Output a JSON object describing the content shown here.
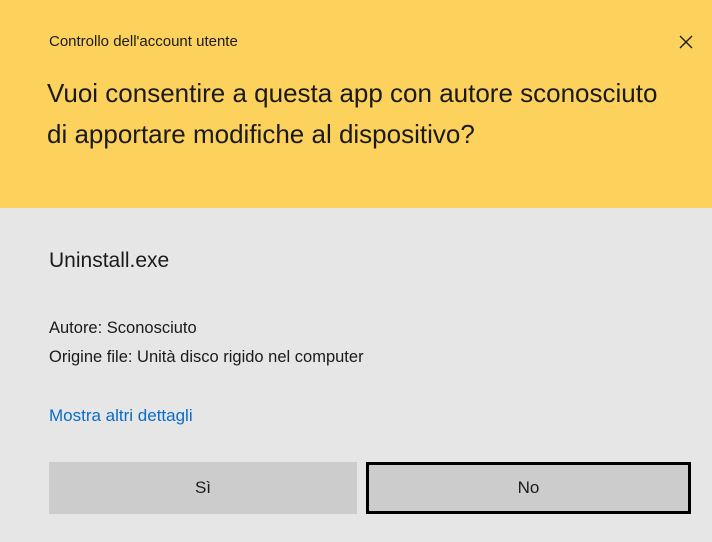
{
  "dialog": {
    "title": "Controllo dell'account utente",
    "close_icon": "close-icon",
    "question": "Vuoi consentire a questa app con autore sconosciuto di apportare modifiche al dispositivo?",
    "app_name": "Uninstall.exe",
    "publisher": "Autore: Sconosciuto",
    "file_origin": "Origine file: Unità disco rigido nel computer",
    "more_details": "Mostra altri dettagli",
    "yes_label": "Sì",
    "no_label": "No"
  },
  "colors": {
    "header_background": "#fcd25c",
    "body_background": "#e6e6e6",
    "button_background": "#cccccc",
    "link": "#0a6bc9"
  }
}
